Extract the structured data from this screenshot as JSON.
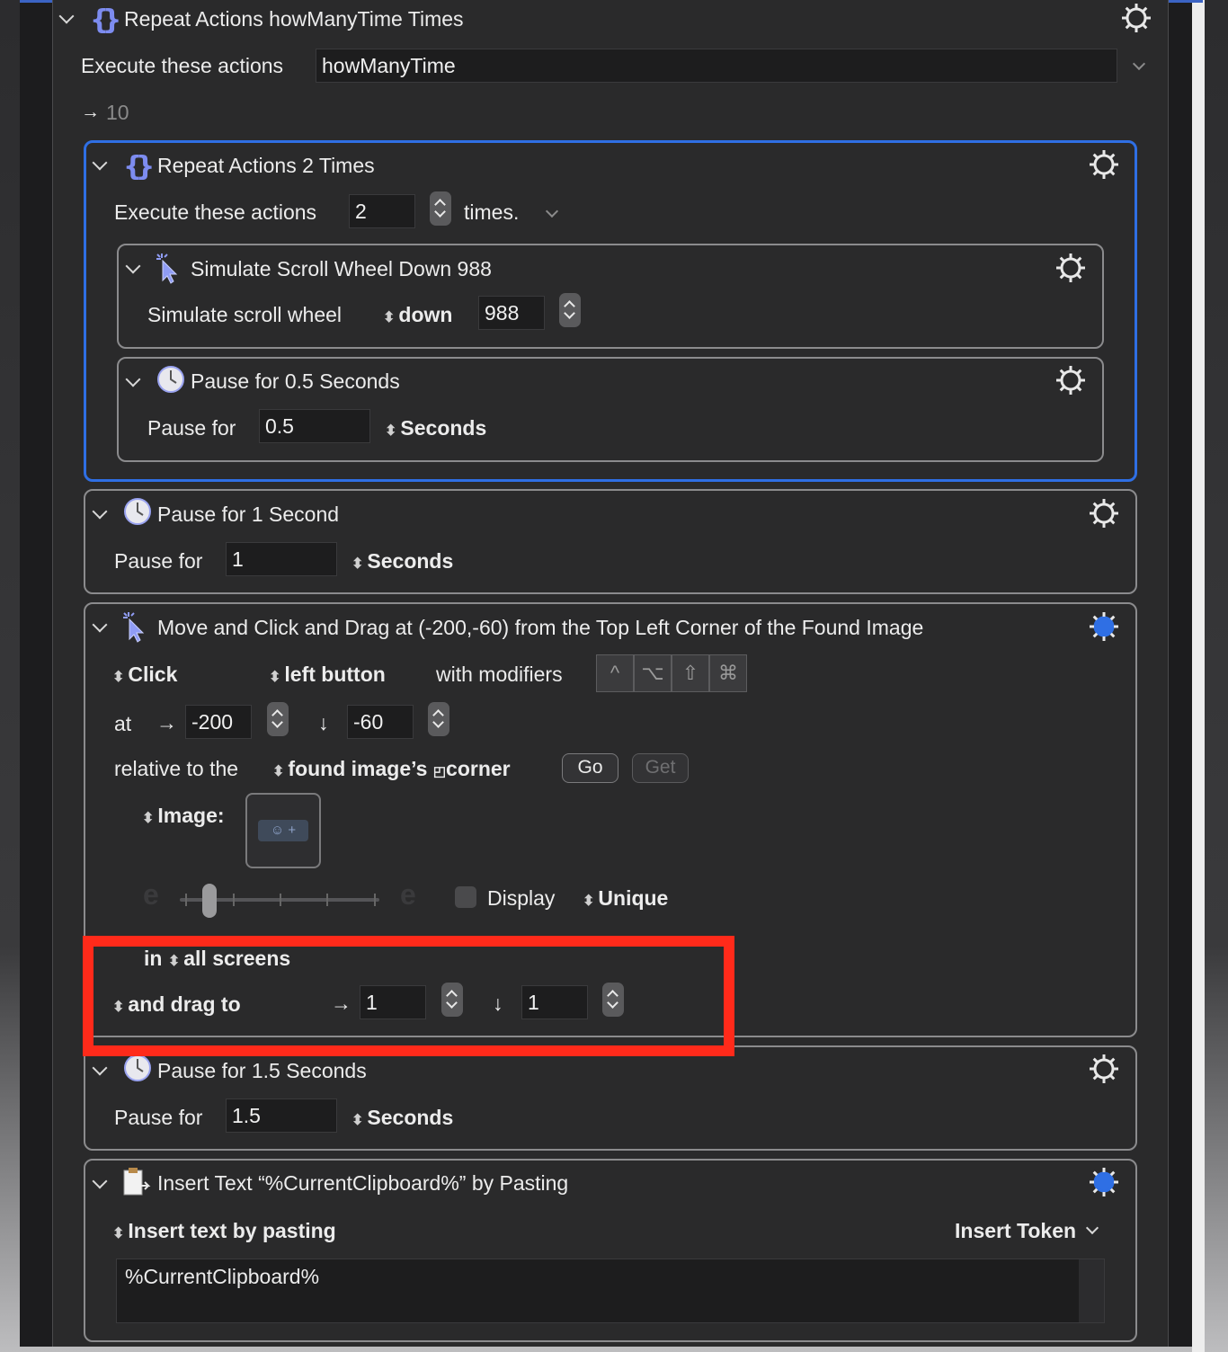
{
  "outer": {
    "title": "Repeat Actions howManyTime Times",
    "label": "Execute these actions",
    "value": "howManyTime",
    "result_arrow": "→",
    "result": "10"
  },
  "repeat2": {
    "title": "Repeat Actions 2 Times",
    "label": "Execute these actions",
    "value": "2",
    "suffix": "times."
  },
  "scroll": {
    "title": "Simulate Scroll Wheel Down 988",
    "label": "Simulate scroll wheel",
    "direction": "down",
    "amount": "988"
  },
  "pause05": {
    "title": "Pause for 0.5 Seconds",
    "label": "Pause for",
    "value": "0.5",
    "unit": "Seconds"
  },
  "pause1": {
    "title": "Pause for 1 Second",
    "label": "Pause for",
    "value": "1",
    "unit": "Seconds"
  },
  "move": {
    "title": "Move and Click and Drag at (-200,-60) from the Top Left Corner of the Found Image",
    "action": "Click",
    "button": "left button",
    "with_modifiers": "with modifiers",
    "modifiers": [
      "^",
      "⌥",
      "⇧",
      "⌘"
    ],
    "at": "at",
    "x": "-200",
    "y": "-60",
    "relative_label": "relative to the",
    "relative_value": "found image’s",
    "corner": "corner",
    "go": "Go",
    "get": "Get",
    "image_label": "Image:",
    "image_well": "☺ +",
    "fuzz_low": "e",
    "fuzz_high": "e",
    "fuzz_level": 0.15,
    "display": "Display",
    "unique": "Unique",
    "in_label": "in",
    "screens": "all screens",
    "drag_label": "and drag to",
    "drag_x": "1",
    "drag_y": "1"
  },
  "pause15": {
    "title": "Pause for 1.5 Seconds",
    "label": "Pause for",
    "value": "1.5",
    "unit": "Seconds"
  },
  "insert": {
    "title": "Insert Text “%CurrentClipboard%” by Pasting",
    "mode": "Insert text by pasting",
    "token": "Insert Token",
    "text": "%CurrentClipboard%"
  },
  "colors": {
    "accent": "#2f6fe4",
    "highlight": "#ff2a1a",
    "panel": "#2a2a2b",
    "field": "#1d1d1e"
  },
  "icons": [
    "repeat-braces-icon",
    "cursor-click-icon",
    "clock-icon",
    "gear-icon",
    "clipboard-icon",
    "chevron-down-icon",
    "updown-icon"
  ]
}
